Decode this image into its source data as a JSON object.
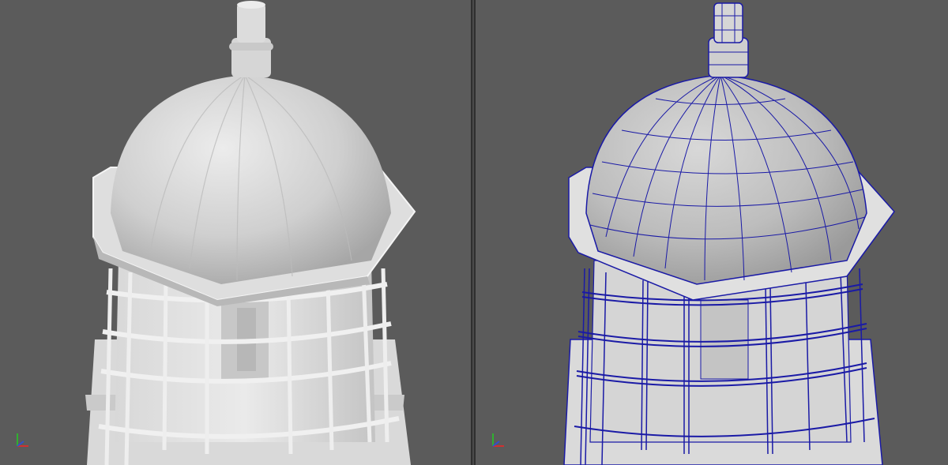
{
  "colors": {
    "viewport_bg": "#5b5b5b",
    "splitter": "#2f2f2f",
    "mesh_light": "#e4e4e4",
    "mesh_shadow": "#a8a8a8",
    "wireframe": "#1a1aa6",
    "axis_x": "#d03030",
    "axis_y": "#30b030",
    "axis_z": "#3050d0"
  },
  "viewports": [
    {
      "name": "shaded",
      "display_mode": "smooth-shaded",
      "wireframe_on_shaded": false
    },
    {
      "name": "wireframe-on-shaded",
      "display_mode": "smooth-shaded",
      "wireframe_on_shaded": true
    }
  ],
  "icons": {
    "axis_gizmo": "axis-gizmo-icon"
  }
}
